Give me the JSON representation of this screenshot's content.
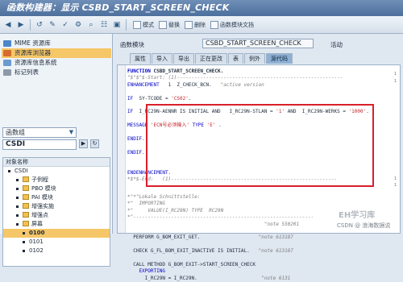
{
  "title": "函数构建器：显示 CSBD_START_SCREEN_CHECK",
  "toolbar": {
    "buttons": [
      "back-icon",
      "forward-icon",
      "history-icon",
      "display-change-icon",
      "activate-icon",
      "test-icon",
      "where-used-icon",
      "hierarchy-icon",
      "pattern-icon"
    ],
    "actions": [
      {
        "label": "模式",
        "icon": "pattern-icon"
      },
      {
        "label": "替换",
        "icon": "replace-icon"
      },
      {
        "label": "删除",
        "icon": "delete-icon"
      },
      {
        "label": "函数模块文挡",
        "icon": "document-icon"
      }
    ]
  },
  "left": {
    "modes": [
      {
        "label": "MIME 资源库",
        "color": "#4d86c9"
      },
      {
        "label": "资源库浏览器",
        "color": "#d56b2f",
        "selected": true
      },
      {
        "label": "资源库信息系统",
        "color": "#6a9bd0"
      },
      {
        "label": "标记列表",
        "color": "#8c99a8"
      }
    ],
    "object_type": "函数组",
    "object_name": "CSDI",
    "tree_header": "对象名称",
    "tree_items": [
      {
        "label": "CSDI",
        "level": 0,
        "bold": false
      },
      {
        "label": "子例程",
        "level": 1,
        "folder": true
      },
      {
        "label": "PBO 模块",
        "level": 1,
        "folder": true
      },
      {
        "label": "PAI 模块",
        "level": 1,
        "folder": true
      },
      {
        "label": "增强实施",
        "level": 1,
        "folder": true
      },
      {
        "label": "增强点",
        "level": 1,
        "folder": true
      },
      {
        "label": "屏幕",
        "level": 1,
        "folder": true
      },
      {
        "label": "0100",
        "level": 2,
        "highlight": true
      },
      {
        "label": "0101",
        "level": 2
      },
      {
        "label": "0102",
        "level": 2
      }
    ]
  },
  "right": {
    "fm_label": "函数模块",
    "fm_name": "CSBD_START_SCREEN_CHECK",
    "fm_status": "活动",
    "tabs": [
      "属性",
      "导入",
      "导出",
      "正在更改",
      "表",
      "例外",
      "源代码"
    ],
    "active_tab": 6
  },
  "code": {
    "lines_top": [
      {
        "parts": [
          [
            "FUNCTION ",
            "kw bold"
          ],
          [
            "CSBD_START_SCREEN_CHECK.",
            "bold"
          ]
        ]
      },
      {
        "parts": [
          [
            "\"$\"$\"$-Start: (1)---------------------------------------------------------",
            "cm"
          ]
        ]
      },
      {
        "parts": [
          [
            "ENHANCEMENT ",
            "kw"
          ],
          [
            "  1  Z_CHECK_BCN.   ",
            ""
          ],
          [
            "\"active version",
            "cm"
          ]
        ]
      },
      {
        "parts": [
          [
            "",
            ""
          ]
        ]
      },
      {
        "parts": [
          [
            "IF ",
            "kw"
          ],
          [
            " SY-TCODE = ",
            ""
          ],
          [
            "'CS02'",
            "str"
          ],
          [
            ".",
            ""
          ]
        ]
      },
      {
        "parts": [
          [
            "",
            ""
          ]
        ]
      },
      {
        "parts": [
          [
            "IF ",
            "kw"
          ],
          [
            " I_RC29N-AENNR IS INITIAL AND   I_RC29N-STLAN = ",
            ""
          ],
          [
            "'1'",
            "str"
          ],
          [
            " AND  I_RC29N-WERKS = ",
            ""
          ],
          [
            "'1000'",
            "str"
          ],
          [
            ".",
            ""
          ]
        ]
      },
      {
        "parts": [
          [
            "",
            ""
          ]
        ]
      },
      {
        "parts": [
          [
            "MESSAGE ",
            "kw"
          ],
          [
            "'ECN号必须输入'",
            "str"
          ],
          [
            " TYPE ",
            "kw"
          ],
          [
            "'E'",
            "str"
          ],
          [
            " .",
            ""
          ]
        ]
      },
      {
        "parts": [
          [
            "",
            ""
          ]
        ]
      },
      {
        "parts": [
          [
            "ENDIF",
            "kw"
          ],
          [
            ".",
            ""
          ]
        ]
      },
      {
        "parts": [
          [
            "",
            ""
          ]
        ]
      },
      {
        "parts": [
          [
            "ENDIF",
            "kw"
          ],
          [
            ".",
            ""
          ]
        ]
      },
      {
        "parts": [
          [
            "",
            ""
          ]
        ]
      },
      {
        "parts": [
          [
            "",
            ""
          ]
        ]
      },
      {
        "parts": [
          [
            "ENDENHANCEMENT",
            "kw"
          ],
          [
            ".",
            ""
          ]
        ]
      },
      {
        "parts": [
          [
            "*$*$-End:   (1)---------------------------------------------------------",
            "cm"
          ]
        ]
      }
    ],
    "lines_bottom": [
      {
        "parts": [
          [
            "*\"*\"Lokale Schnittstelle:",
            "cm"
          ]
        ]
      },
      {
        "parts": [
          [
            "*\"  IMPORTING",
            "cm"
          ]
        ]
      },
      {
        "parts": [
          [
            "*\"     VALUE(I_RC29N) TYPE  RC29N",
            "cm"
          ]
        ]
      },
      {
        "parts": [
          [
            "*\"--------------------------------------------------------------",
            "cm"
          ]
        ]
      },
      {
        "parts": [
          [
            "                                               ",
            ""
          ],
          [
            "\"note 550201",
            "cm"
          ]
        ]
      },
      {
        "parts": [
          [
            "",
            ""
          ]
        ]
      },
      {
        "parts": [
          [
            "  PERFORM G_BOM_EXIT_GET.                    ",
            ""
          ],
          [
            "\"note 613187",
            "cm"
          ]
        ]
      },
      {
        "parts": [
          [
            "",
            ""
          ]
        ]
      },
      {
        "parts": [
          [
            "  CHECK G_FL_BOM_EXIT_INACTIVE IS INITIAL.   ",
            ""
          ],
          [
            "\"note 613187",
            "cm"
          ]
        ]
      },
      {
        "parts": [
          [
            "",
            ""
          ]
        ]
      },
      {
        "parts": [
          [
            "  CALL METHOD G_BOM_EXIT->START_SCREEN_CHECK",
            ""
          ]
        ]
      },
      {
        "parts": [
          [
            "    EXPORTING",
            "kw"
          ]
        ]
      },
      {
        "parts": [
          [
            "      I_RC29N = I_RC29N.                      ",
            ""
          ],
          [
            "\"note 6131",
            "cm"
          ]
        ]
      }
    ],
    "right_marks": [
      "1",
      "1",
      "1",
      "1"
    ]
  },
  "watermark": "EH学习库",
  "csdn": "CSDN @ 浪海数据说"
}
